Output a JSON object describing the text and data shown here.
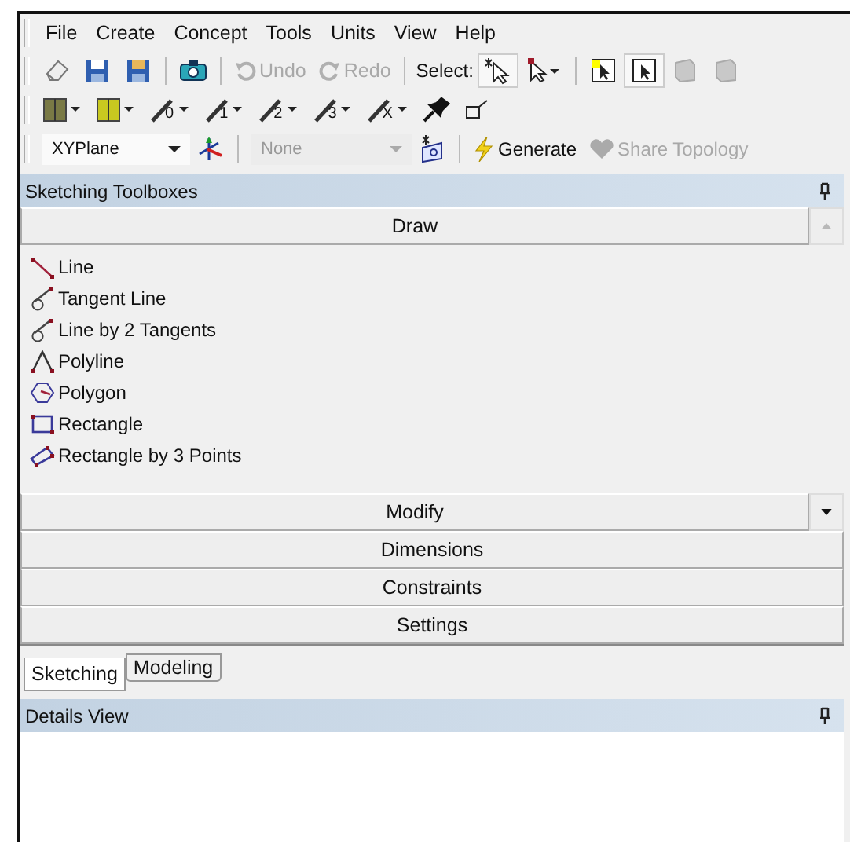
{
  "menu": [
    "File",
    "Create",
    "Concept",
    "Tools",
    "Units",
    "View",
    "Help"
  ],
  "toolbar_main": [
    {
      "kind": "eraser"
    },
    {
      "kind": "save"
    },
    {
      "kind": "save-all"
    },
    {
      "kind": "sep"
    },
    {
      "kind": "camera"
    },
    {
      "kind": "sep"
    },
    {
      "kind": "undo",
      "label": "Undo",
      "disabled": true
    },
    {
      "kind": "redo",
      "label": "Redo",
      "disabled": true
    },
    {
      "kind": "sep"
    },
    {
      "kind": "text",
      "label": "Select:"
    },
    {
      "kind": "select-new",
      "pressed": true
    },
    {
      "kind": "select-mode"
    },
    {
      "kind": "sep"
    },
    {
      "kind": "select-point",
      "pressed": false
    },
    {
      "kind": "select-edge",
      "pressed": true
    },
    {
      "kind": "select-face",
      "disabled": true
    },
    {
      "kind": "select-body",
      "disabled": true
    }
  ],
  "toolbar_lines": [
    {
      "kind": "swatch",
      "color": "#7a7a45"
    },
    {
      "kind": "swatch",
      "color": "#c8c820"
    },
    {
      "kind": "line",
      "label": "0"
    },
    {
      "kind": "line",
      "label": "1"
    },
    {
      "kind": "line",
      "label": "2"
    },
    {
      "kind": "line",
      "label": "3"
    },
    {
      "kind": "line",
      "label": "X"
    },
    {
      "kind": "pin"
    },
    {
      "kind": "frame"
    }
  ],
  "toolbar_sketch": {
    "plane": "XYPlane",
    "sketch": {
      "value": "None",
      "disabled": true
    },
    "generate": {
      "label": "Generate",
      "disabled": false
    },
    "share": {
      "label": "Share Topology",
      "disabled": true
    }
  },
  "toolboxes": {
    "title": "Sketching Toolboxes",
    "sections": [
      {
        "label": "Draw",
        "scroll_button": {
          "kind": "up",
          "disabled": true
        },
        "items": [
          {
            "kind": "line",
            "label": "Line"
          },
          {
            "kind": "tangent",
            "label": "Tangent Line"
          },
          {
            "kind": "tangent",
            "label": "Line by 2 Tangents"
          },
          {
            "kind": "polyline",
            "label": "Polyline"
          },
          {
            "kind": "polygon",
            "label": "Polygon"
          },
          {
            "kind": "rectangle",
            "label": "Rectangle"
          },
          {
            "kind": "rect3",
            "label": "Rectangle by 3 Points"
          }
        ]
      },
      {
        "label": "Modify",
        "scroll_button": {
          "kind": "down",
          "disabled": false
        }
      },
      {
        "label": "Dimensions"
      },
      {
        "label": "Constraints"
      },
      {
        "label": "Settings"
      }
    ]
  },
  "tabs": [
    {
      "label": "Sketching",
      "selected": true
    },
    {
      "label": "Modeling",
      "selected": false
    }
  ],
  "details": {
    "title": "Details View"
  }
}
